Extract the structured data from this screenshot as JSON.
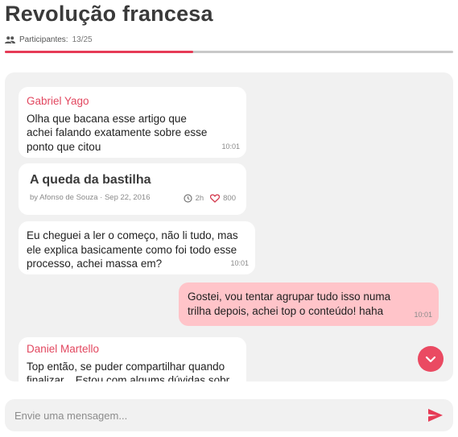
{
  "header": {
    "title": "Revolução francesa",
    "participants_label": "Participantes:",
    "participants_count": "13/25",
    "progress_fraction": 0.42
  },
  "messages": [
    {
      "sender": "Gabriel Yago",
      "lines": [
        "Olha que bacana esse artigo que",
        "achei falando exatamente sobre esse",
        "ponto que citou"
      ],
      "time": "10:01"
    },
    {
      "lines": [
        "Eu cheguei a ler o começo, não li tudo, mas",
        "ele explica basicamente como foi todo esse",
        "processo, achei massa em?"
      ],
      "time": "10:01"
    },
    {
      "own": true,
      "lines": [
        "Gostei, vou tentar agrupar tudo isso numa",
        "trilha depois, achei top o conteúdo! haha"
      ],
      "time": "10:01"
    },
    {
      "sender": "Daniel Martello",
      "lines": [
        "Top então, se puder compartilhar quando",
        "finalizar... Estou com algums dúvidas sobr"
      ]
    }
  ],
  "article_card": {
    "title": "A queda da bastilha",
    "meta": "by Afonso de Souza · Sep 22, 2016",
    "read_time": "2h",
    "likes": "800"
  },
  "composer": {
    "placeholder": "Envie uma mensagem..."
  },
  "colors": {
    "accent": "#e63b56",
    "own_bubble": "#ffc4c9",
    "chat_bg": "#f1f1f1"
  },
  "icons": [
    "people-icon",
    "clock-icon",
    "heart-icon",
    "chevron-down-icon",
    "send-icon"
  ]
}
